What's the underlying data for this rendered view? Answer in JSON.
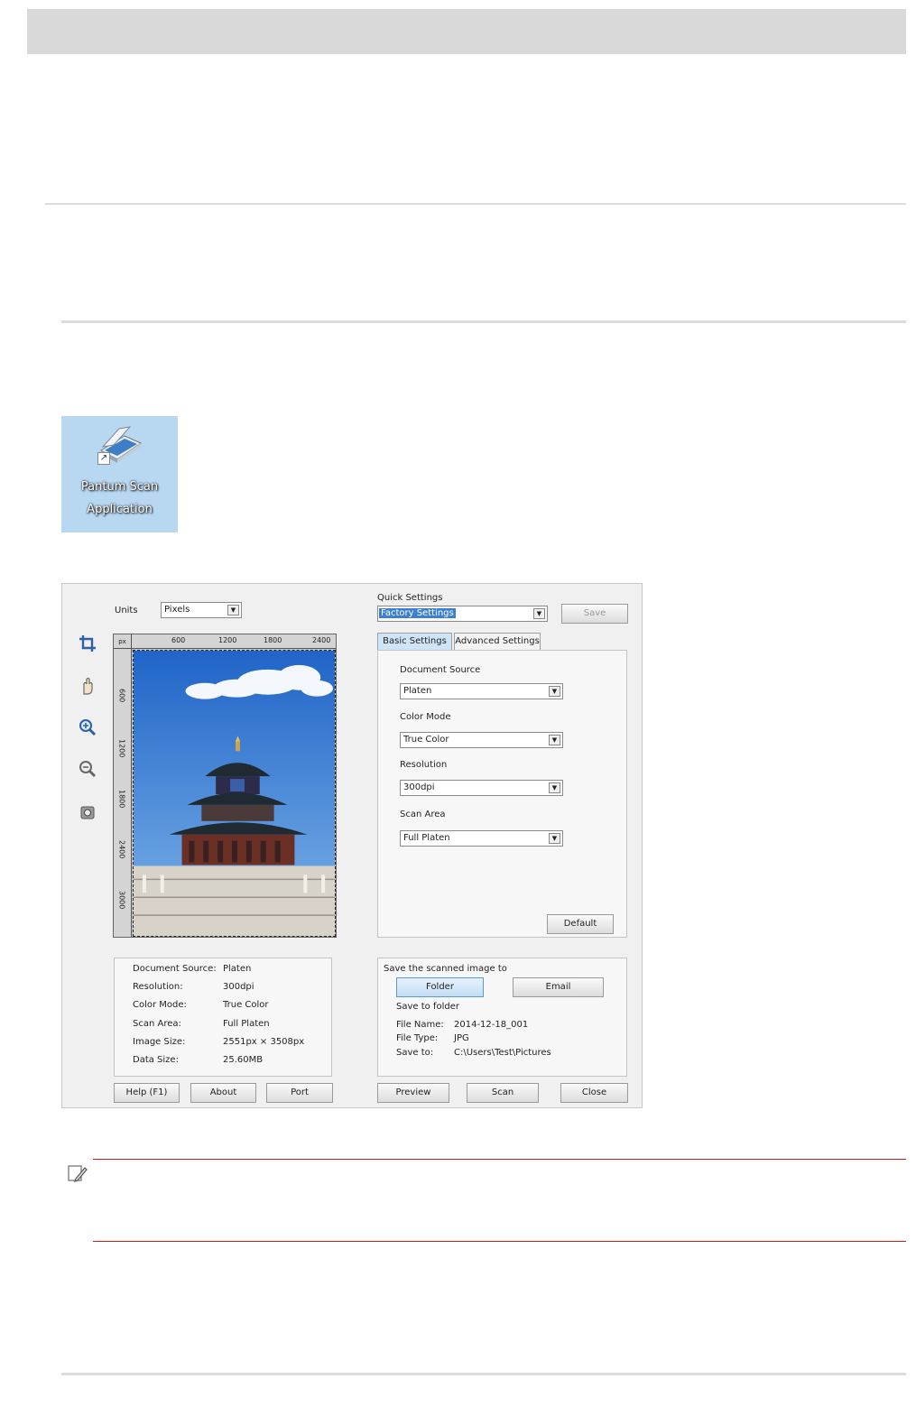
{
  "desktop_icon": {
    "label_line1": "Pantum Scan",
    "label_line2": "Application",
    "icon": "scanner-icon"
  },
  "app": {
    "units_label": "Units",
    "units_value": "Pixels",
    "quick_settings_label": "Quick Settings",
    "quick_settings_value": "Factory Settings",
    "save_button": "Save",
    "tools": [
      "crop-icon",
      "hand-icon",
      "zoom-in-icon",
      "zoom-out-icon",
      "clear-icon"
    ],
    "ruler": {
      "unit": "px",
      "top_ticks": [
        "600",
        "1200",
        "1800",
        "2400"
      ],
      "left_ticks": [
        "600",
        "1200",
        "1800",
        "2400",
        "3000"
      ]
    },
    "tabs": [
      "Basic Settings",
      "Advanced Settings"
    ],
    "basic": {
      "document_source_label": "Document Source",
      "document_source_value": "Platen",
      "color_mode_label": "Color Mode",
      "color_mode_value": "True Color",
      "resolution_label": "Resolution",
      "resolution_value": "300dpi",
      "scan_area_label": "Scan Area",
      "scan_area_value": "Full Platen",
      "default_button": "Default"
    },
    "info": [
      {
        "key": "Document Source:",
        "value": "Platen"
      },
      {
        "key": "Resolution:",
        "value": "300dpi"
      },
      {
        "key": "Color Mode:",
        "value": "True Color"
      },
      {
        "key": "Scan Area:",
        "value": "Full Platen"
      },
      {
        "key": "Image Size:",
        "value": "2551px × 3508px"
      },
      {
        "key": "Data Size:",
        "value": "25.60MB"
      }
    ],
    "save_target": {
      "title": "Save the scanned image to",
      "folder_button": "Folder",
      "email_button": "Email",
      "subtitle": "Save to folder",
      "file_name_label": "File Name:",
      "file_name_value": "2014-12-18_001",
      "file_type_label": "File Type:",
      "file_type_value": "JPG",
      "save_to_label": "Save to:",
      "save_to_value": "C:\\Users\\Test\\Pictures"
    },
    "bottom_buttons": {
      "help": "Help (F1)",
      "about": "About",
      "port": "Port",
      "preview": "Preview",
      "scan": "Scan",
      "close": "Close"
    }
  },
  "colors": {
    "header_band": "#d9d9d9",
    "note_rule": "#cc1e1e",
    "desktop_bg": "#b8d7f1"
  }
}
